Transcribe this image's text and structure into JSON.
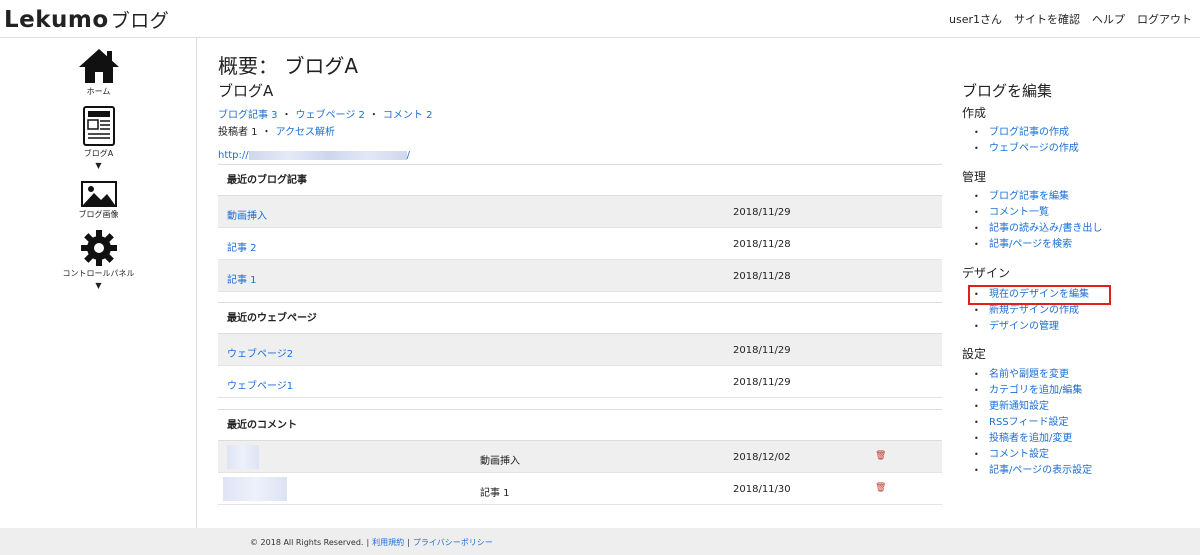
{
  "header": {
    "logo_main": "Lekumo",
    "logo_suffix": "ブログ",
    "user": "user1さん",
    "view_site": "サイトを確認",
    "help": "ヘルプ",
    "logout": "ログアウト"
  },
  "sidebar": {
    "items": [
      {
        "label": "ホーム",
        "icon": "home-icon"
      },
      {
        "label": "ブログA",
        "icon": "blog-icon"
      },
      {
        "label": "ブログ画像",
        "icon": "image-icon"
      },
      {
        "label": "コントロールパネル",
        "icon": "gear-icon"
      }
    ]
  },
  "main": {
    "title": "概要： ブログA",
    "blog_name": "ブログA",
    "stats": {
      "posts": "ブログ記事 3",
      "pages": "ウェブページ 2",
      "comments": "コメント 2",
      "authors": "投稿者 1",
      "analytics": "アクセス解析",
      "sep": "・"
    },
    "url_prefix": "http://",
    "url_suffix": "/",
    "recent_posts": {
      "heading": "最近のブログ記事",
      "rows": [
        {
          "title": "動画挿入",
          "date": "2018/11/29"
        },
        {
          "title": "記事 2",
          "date": "2018/11/28"
        },
        {
          "title": "記事 1",
          "date": "2018/11/28"
        }
      ]
    },
    "recent_pages": {
      "heading": "最近のウェブページ",
      "rows": [
        {
          "title": "ウェブページ2",
          "date": "2018/11/29"
        },
        {
          "title": "ウェブページ1",
          "date": "2018/11/29"
        }
      ]
    },
    "recent_comments": {
      "heading": "最近のコメント",
      "rows": [
        {
          "post": "動画挿入",
          "date": "2018/12/02"
        },
        {
          "post": "記事 1",
          "date": "2018/11/30"
        }
      ]
    }
  },
  "right": {
    "title": "ブログを編集",
    "create": {
      "heading": "作成",
      "items": [
        "ブログ記事の作成",
        "ウェブページの作成"
      ]
    },
    "manage": {
      "heading": "管理",
      "items": [
        "ブログ記事を編集",
        "コメント一覧",
        "記事の読み込み/書き出し",
        "記事/ページを検索"
      ]
    },
    "design": {
      "heading": "デザイン",
      "items": [
        "現在のデザインを編集",
        "新規デザインの作成",
        "デザインの管理"
      ]
    },
    "settings": {
      "heading": "設定",
      "items": [
        "名前や副題を変更",
        "カテゴリを追加/編集",
        "更新通知設定",
        "RSSフィード設定",
        "投稿者を追加/変更",
        "コメント設定",
        "記事/ページの表示設定"
      ]
    }
  },
  "footer": {
    "copyright": "© 2018 All Rights Reserved.",
    "terms": "利用規約",
    "privacy": "プライバシーポリシー",
    "sep": "|"
  },
  "colors": {
    "link": "#1a6fd6",
    "highlight": "#e02020",
    "trash": "#c0392b"
  }
}
